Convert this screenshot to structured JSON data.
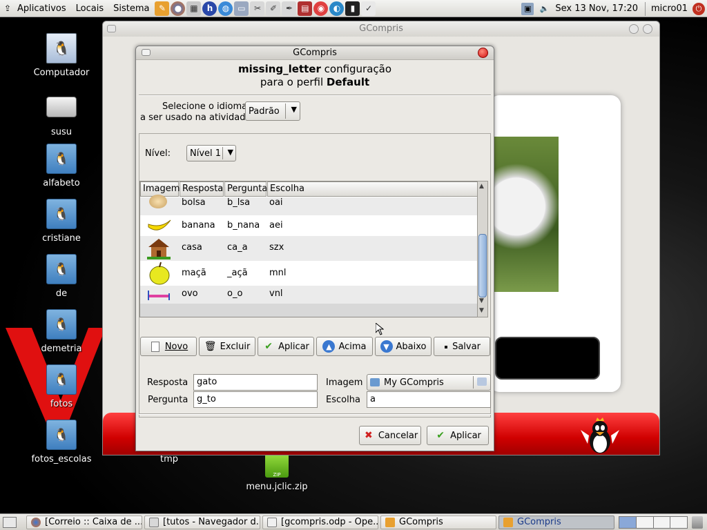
{
  "top_panel": {
    "menus": [
      "Aplicativos",
      "Locais",
      "Sistema"
    ],
    "clock": "Sex 13 Nov, 17:20",
    "user": "micro01"
  },
  "desktop": {
    "icons": [
      {
        "label": "Computador"
      },
      {
        "label": "susu"
      },
      {
        "label": "alfabeto"
      },
      {
        "label": "cristiane"
      },
      {
        "label": "de"
      },
      {
        "label": "demetria"
      },
      {
        "label": "fotos"
      },
      {
        "label": "fotos_escolas"
      },
      {
        "label": "tmp"
      },
      {
        "label": "menu.jclic.zip"
      }
    ],
    "zip_badge": "ZIP"
  },
  "main_window": {
    "title": "GCompris"
  },
  "dialog": {
    "title": "GCompris",
    "heading_bold": "missing_letter",
    "heading_rest": " configuração",
    "heading_line2_pre": "para o perfil ",
    "heading_line2_bold": "Default",
    "language_label_1": "Selecione o idioma",
    "language_label_2": "a ser usado na atividade",
    "language_value": "Padrão",
    "level_label": "Nível:",
    "level_value": "Nível 1",
    "columns": [
      "Imagem",
      "Resposta",
      "Pergunta",
      "Escolha"
    ],
    "rows": [
      {
        "image": "bag",
        "resposta": "bolsa",
        "pergunta": "b_lsa",
        "escolha": "oai"
      },
      {
        "image": "banana",
        "resposta": "banana",
        "pergunta": "b_nana",
        "escolha": "aei"
      },
      {
        "image": "house",
        "resposta": "casa",
        "pergunta": "ca_a",
        "escolha": "szx"
      },
      {
        "image": "apple",
        "resposta": "maçã",
        "pergunta": "_açã",
        "escolha": "mnl"
      },
      {
        "image": "bed",
        "resposta": "ovo",
        "pergunta": "o_o",
        "escolha": "vnl"
      }
    ],
    "buttons": {
      "novo": "Novo",
      "excluir": "Excluir",
      "aplicar": "Aplicar",
      "acima": "Acima",
      "abaixo": "Abaixo",
      "salvar": "Salvar"
    },
    "form": {
      "resposta_label": "Resposta",
      "resposta_value": "gato",
      "pergunta_label": "Pergunta",
      "pergunta_value": "g_to",
      "imagem_label": "Imagem",
      "imagem_value": "My GCompris",
      "escolha_label": "Escolha",
      "escolha_value": "a"
    },
    "cancel_label": "Cancelar",
    "apply_label": "Aplicar"
  },
  "taskbar": {
    "tasks": [
      {
        "label": "[Correio :: Caixa de ...",
        "active": false
      },
      {
        "label": "[tutos - Navegador d...",
        "active": false
      },
      {
        "label": "[gcompris.odp - Ope...",
        "active": false
      },
      {
        "label": "GCompris",
        "active": false
      },
      {
        "label": "GCompris",
        "active": true
      }
    ]
  },
  "colors": {
    "accent_red": "#d00000",
    "selection_blue": "#8fb0da"
  }
}
